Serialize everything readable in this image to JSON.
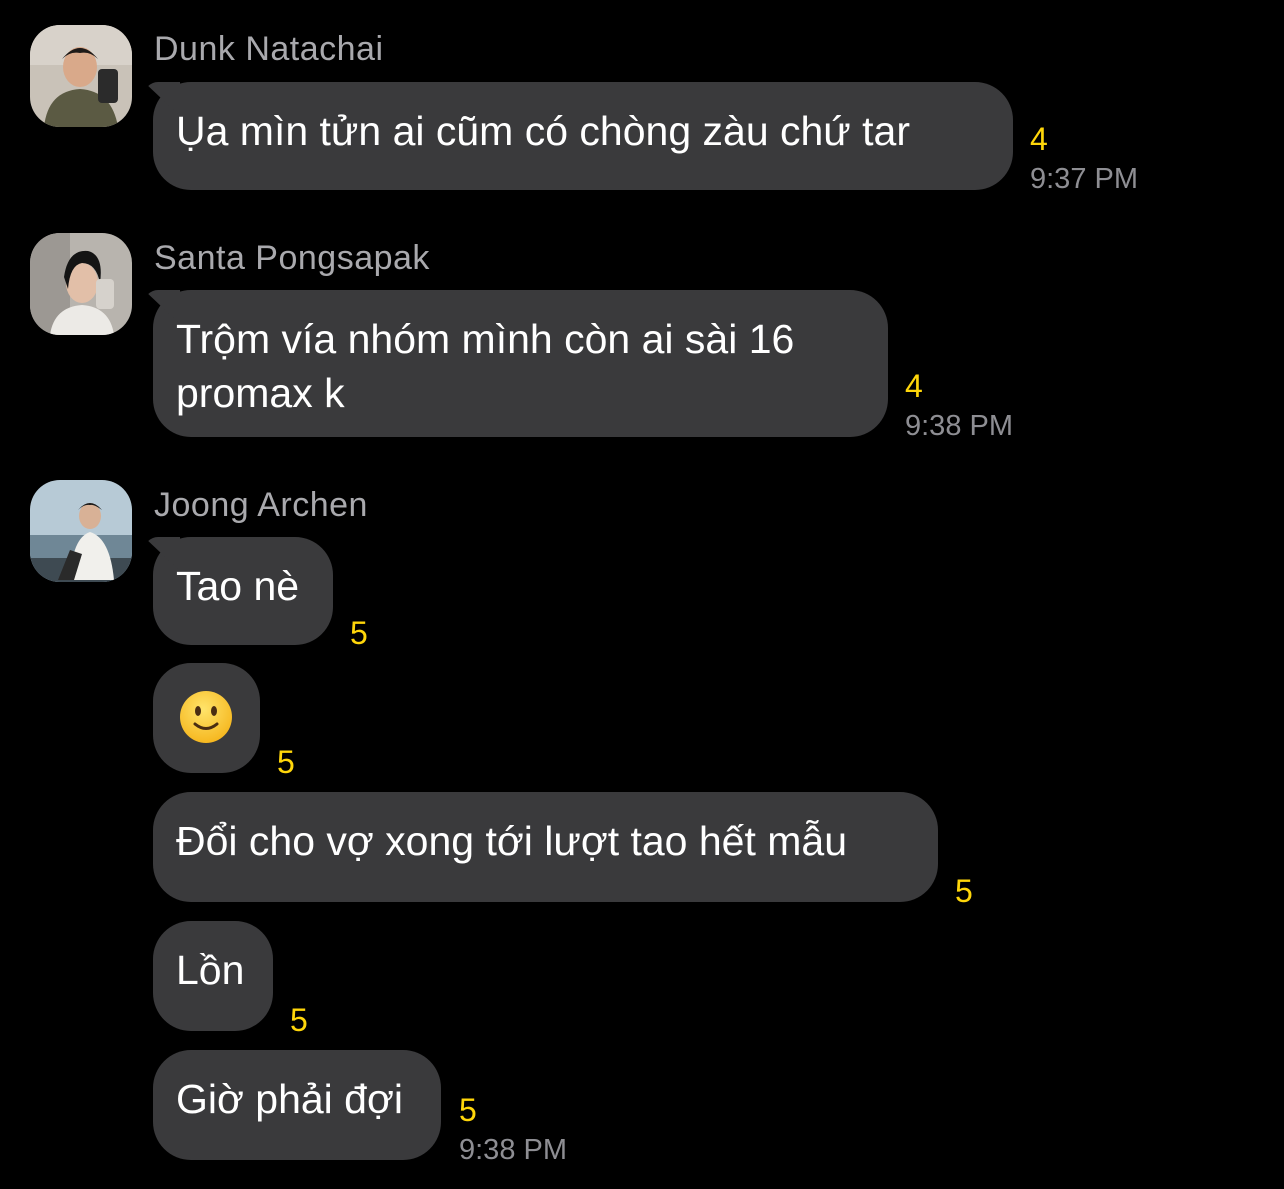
{
  "colors": {
    "background": "#000000",
    "bubble": "#3a3a3c",
    "sender_name": "#a9a9ad",
    "timestamp": "#8e8e93",
    "reaction_count": "#ffd60a"
  },
  "messages": [
    {
      "sender": "Dunk Natachai",
      "avatar": "avatar-dunk",
      "bubbles": [
        {
          "text": "Ụa mìn tửn ai cũm có chòng zàu chứ tar",
          "count": "4",
          "time": "9:37 PM"
        }
      ]
    },
    {
      "sender": "Santa Pongsapak",
      "avatar": "avatar-santa",
      "bubbles": [
        {
          "line1": "Trộm vía nhóm mình còn ai sài 16",
          "line2": "promax k",
          "count": "4",
          "time": "9:38 PM"
        }
      ]
    },
    {
      "sender": "Joong Archen",
      "avatar": "avatar-joong",
      "bubbles": [
        {
          "text": "Tao nè",
          "count": "5"
        },
        {
          "emoji": "slightly-smiling-face-icon",
          "count": "5"
        },
        {
          "text": "Đổi cho vợ xong tới lượt tao hết mẫu",
          "count": "5"
        },
        {
          "text": "Lồn",
          "count": "5"
        },
        {
          "text": "Giờ phải đợi",
          "count": "5",
          "time": "9:38 PM"
        }
      ]
    }
  ]
}
